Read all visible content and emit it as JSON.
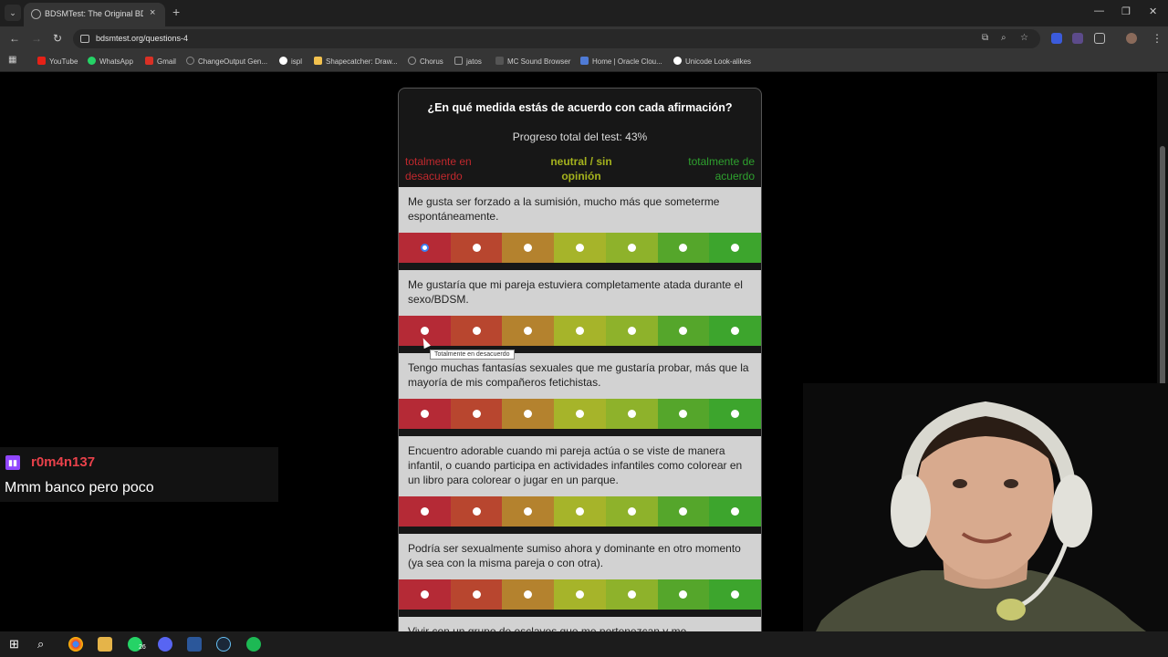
{
  "browser": {
    "tab_title": "BDSMTest: The Original BDSM",
    "tab_close": "×",
    "new_tab": "+",
    "url": "bdsmtest.org/questions-4",
    "window_controls": {
      "minimize": "—",
      "maximize": "❐",
      "close": "✕"
    }
  },
  "bookmarks": [
    {
      "label": "YouTube",
      "color": "#e62117"
    },
    {
      "label": "WhatsApp",
      "color": "#25d366"
    },
    {
      "label": "Gmail",
      "color": "#d93025"
    },
    {
      "label": "ChangeOutput Gen...",
      "color": "#888888"
    },
    {
      "label": "ispl",
      "color": "#ffffff"
    },
    {
      "label": "Shapecatcher: Draw...",
      "color": "#f2c14e"
    },
    {
      "label": "Chorus",
      "color": "#999999"
    },
    {
      "label": "jatos",
      "color": "#999999"
    },
    {
      "label": "MC Sound Browser",
      "color": "#666666"
    },
    {
      "label": "Home | Oracle Clou...",
      "color": "#4f7bd6"
    },
    {
      "label": "Unicode Look-alikes",
      "color": "#ffffff"
    }
  ],
  "quiz": {
    "title": "¿En qué medida estás de acuerdo con cada afirmación?",
    "progress_text": "Progreso total del test: 43%",
    "progress_percent": 43,
    "scale": {
      "left": "totalmente en desacuerdo",
      "middle": "neutral / sin opinión",
      "right": "totalmente de acuerdo"
    },
    "colors": [
      "#b52a36",
      "#b8462f",
      "#b4822e",
      "#a6b42a",
      "#8eb22b",
      "#55a62b",
      "#3da52d"
    ],
    "questions": [
      {
        "text": "Me gusta ser forzado a la sumisión, mucho más que someterme espontáneamente.",
        "selected": 1
      },
      {
        "text": "Me gustaría que mi pareja estuviera completamente atada durante el sexo/BDSM.",
        "selected": null
      },
      {
        "text": "Tengo muchas fantasías sexuales que me gustaría probar, más que la mayoría de mis compañeros fetichistas.",
        "selected": null
      },
      {
        "text": "Encuentro adorable cuando mi pareja actúa o se viste de manera infantil, o cuando participa en actividades infantiles como colorear en un libro para colorear o jugar en un parque.",
        "selected": null
      },
      {
        "text": "Podría ser sexualmente sumiso ahora y dominante en otro momento (ya sea con la misma pareja o con otra).",
        "selected": null
      },
      {
        "text": "Vivir con un grupo de esclavos que me pertenezcan y me",
        "selected": null
      }
    ],
    "tooltip": "Totalmente en desacuerdo"
  },
  "chat": {
    "username": "r0m4n137",
    "message": "Mmm banco pero poco"
  },
  "taskbar": {
    "badge_count": "26"
  }
}
